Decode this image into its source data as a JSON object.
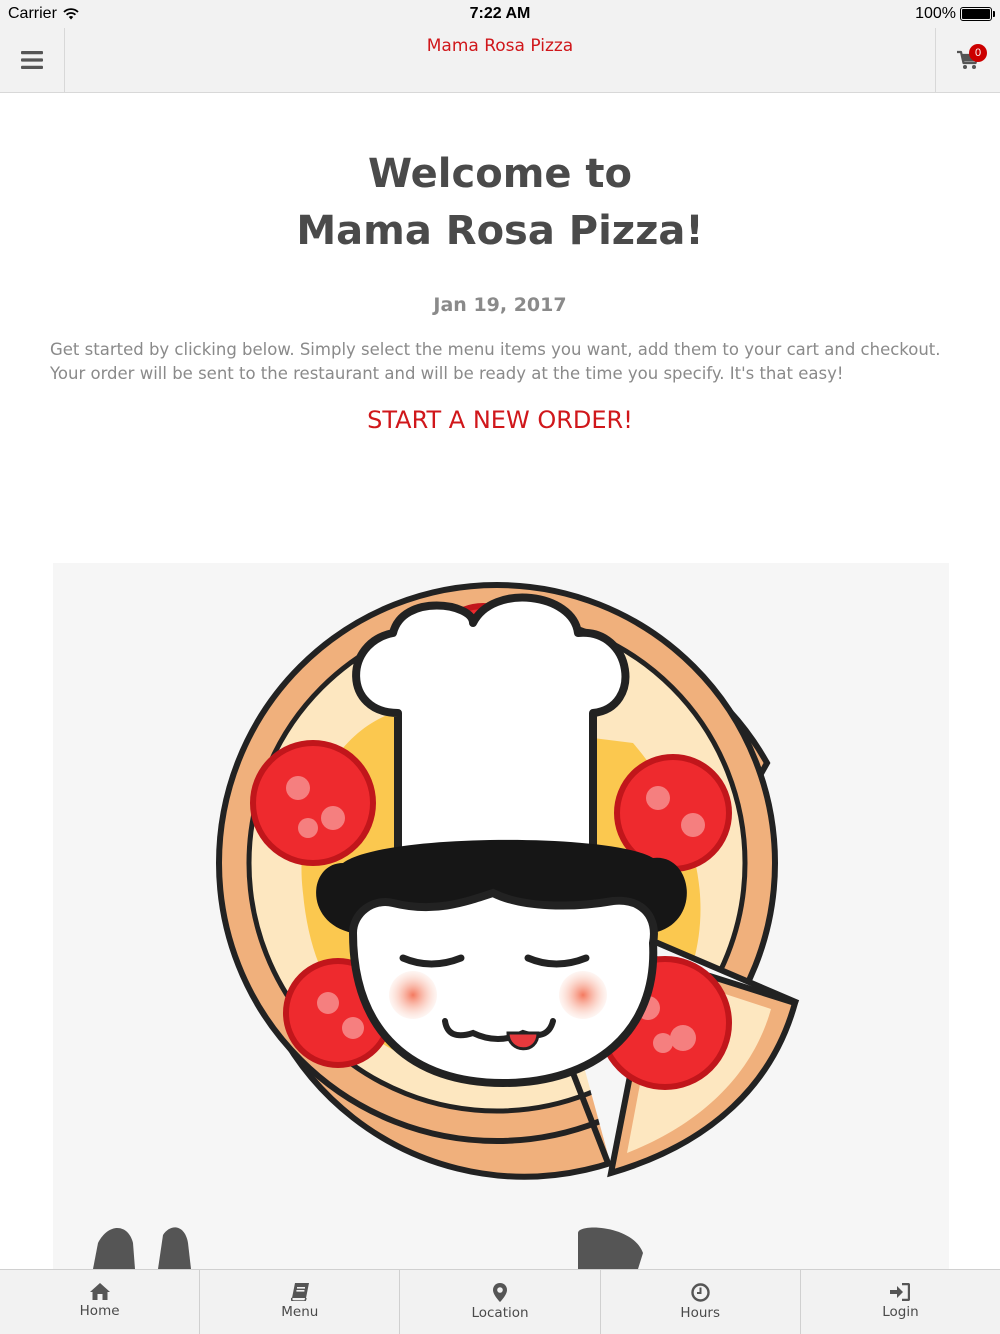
{
  "status_bar": {
    "carrier": "Carrier",
    "time": "7:22 AM",
    "battery": "100%"
  },
  "header": {
    "title": "Mama Rosa Pizza",
    "cart_count": "0"
  },
  "main": {
    "welcome_line1": "Welcome to",
    "welcome_line2": "Mama Rosa Pizza!",
    "date": "Jan 19, 2017",
    "intro": "Get started by clicking below. Simply select the menu items you want, add them to your cart and checkout. Your order will be sent to the restaurant and will be ready at the time you specify. It's that easy!",
    "cta": "START A NEW ORDER!"
  },
  "tabs": [
    {
      "label": "Home",
      "icon": "home-icon"
    },
    {
      "label": "Menu",
      "icon": "book-icon"
    },
    {
      "label": "Location",
      "icon": "map-pin-icon"
    },
    {
      "label": "Hours",
      "icon": "clock-icon"
    },
    {
      "label": "Login",
      "icon": "sign-in-icon"
    }
  ],
  "colors": {
    "accent": "#d0171b",
    "bar_bg": "#f2f2f2",
    "heading": "#4a4a4a",
    "body_text": "#8a8a8a"
  }
}
